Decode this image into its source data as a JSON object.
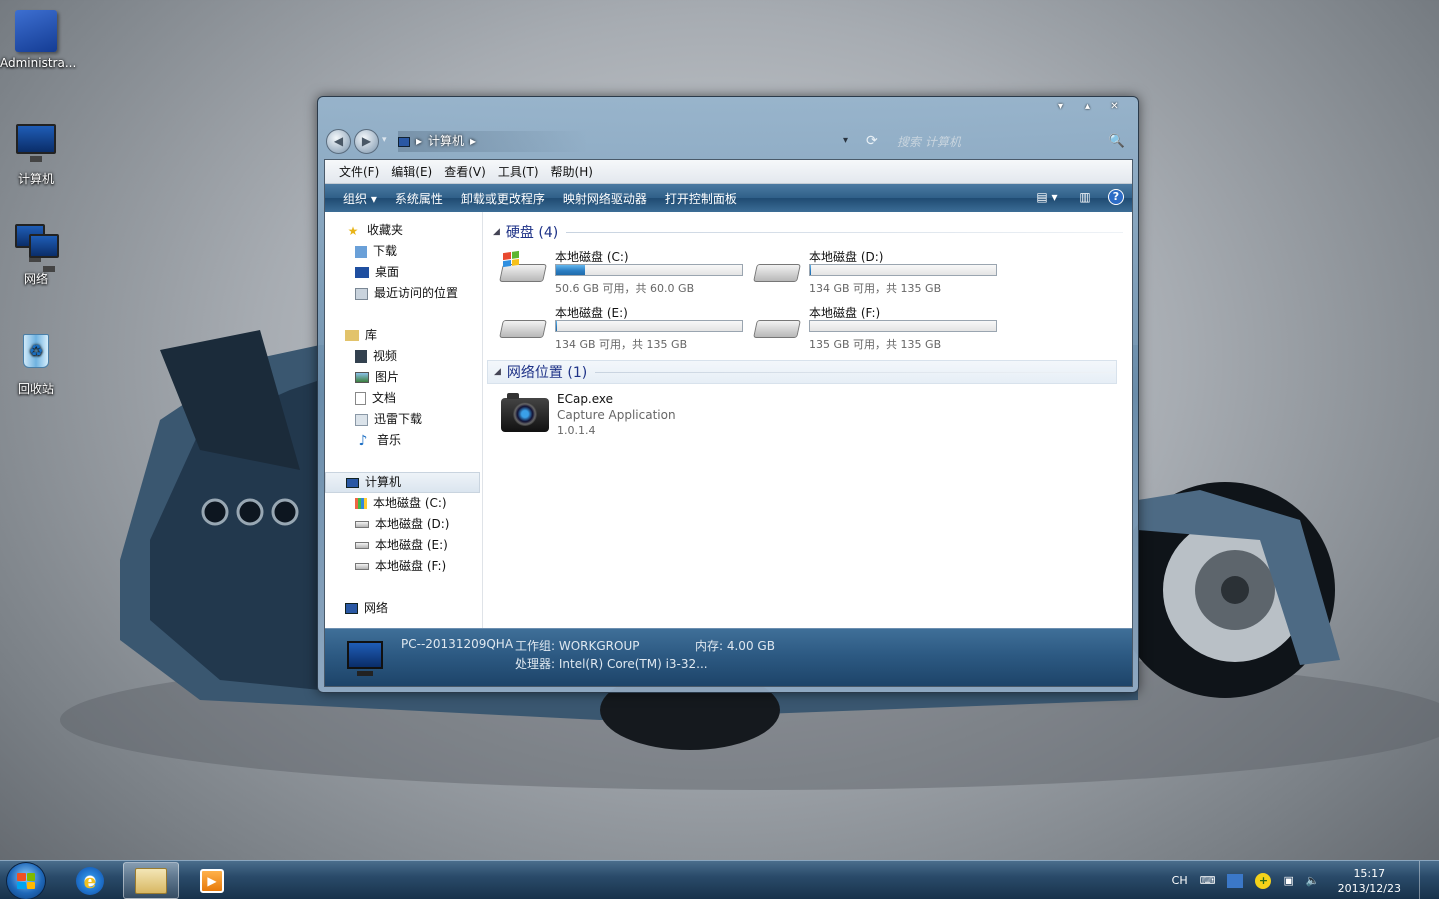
{
  "desktop": {
    "icons": [
      {
        "label": "Administra...",
        "icon": "user-folder-icon"
      },
      {
        "label": "计算机",
        "icon": "computer-icon"
      },
      {
        "label": "网络",
        "icon": "network-icon"
      },
      {
        "label": "回收站",
        "icon": "recycle-bin-icon"
      }
    ]
  },
  "window": {
    "controls": {
      "minimize": "▾",
      "maximize": "▴",
      "close": "✕"
    },
    "nav": {
      "back": "◀",
      "forward": "▶",
      "dropdown": "▾"
    },
    "address": {
      "path": "计算机",
      "sep": "▸"
    },
    "search": {
      "placeholder": "搜索 计算机",
      "icon": "🔍"
    },
    "menu": [
      "文件(F)",
      "编辑(E)",
      "查看(V)",
      "工具(T)",
      "帮助(H)"
    ],
    "toolbar": {
      "organize": "组织 ▾",
      "items": [
        "系统属性",
        "卸载或更改程序",
        "映射网络驱动器",
        "打开控制面板"
      ],
      "views_icon": "▤ ▾",
      "preview_icon": "▥",
      "help": "?"
    },
    "navpane": {
      "favorites": {
        "label": "收藏夹",
        "items": [
          "下载",
          "桌面",
          "最近访问的位置"
        ]
      },
      "libraries": {
        "label": "库",
        "items": [
          "视频",
          "图片",
          "文档",
          "迅雷下载",
          "音乐"
        ]
      },
      "computer": {
        "label": "计算机",
        "items": [
          "本地磁盘 (C:)",
          "本地磁盘 (D:)",
          "本地磁盘 (E:)",
          "本地磁盘 (F:)"
        ]
      },
      "network": {
        "label": "网络"
      }
    },
    "groups": {
      "drives_header": "硬盘 (4)",
      "network_header": "网络位置 (1)"
    },
    "drives": [
      {
        "name": "本地磁盘 (C:)",
        "info": "50.6 GB 可用，共 60.0 GB",
        "used_fraction": 0.157
      },
      {
        "name": "本地磁盘 (D:)",
        "info": "134 GB 可用，共 135 GB",
        "used_fraction": 0.007
      },
      {
        "name": "本地磁盘 (E:)",
        "info": "134 GB 可用，共 135 GB",
        "used_fraction": 0.007
      },
      {
        "name": "本地磁盘 (F:)",
        "info": "135 GB 可用，共 135 GB",
        "used_fraction": 0.0
      }
    ],
    "network_item": {
      "name": "ECap.exe",
      "desc": "Capture Application",
      "version": "1.0.1.4"
    },
    "details": {
      "pc_name": "PC--20131209QHA",
      "workgroup": "工作组: WORKGROUP",
      "memory": "内存: 4.00 GB",
      "processor": "处理器: Intel(R) Core(TM) i3-32..."
    }
  },
  "taskbar": {
    "ime": "CH",
    "time": "15:17",
    "date": "2013/12/23",
    "media_glyph": "▶"
  },
  "colors": {
    "toolbar": "#2f5f88",
    "group_header": "#1e3287",
    "drive_fill": "#2c7fc4"
  }
}
